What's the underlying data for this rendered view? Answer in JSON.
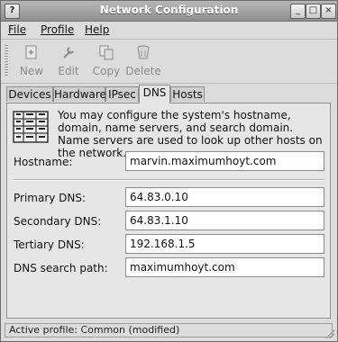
{
  "window": {
    "title": "Network Configuration"
  },
  "titlebar_buttons": {
    "help": "?",
    "minimize": "_",
    "maximize": "□",
    "close": "×"
  },
  "menu": [
    {
      "label": "File",
      "mnemonic": "F"
    },
    {
      "label": "Profile",
      "mnemonic": "P"
    },
    {
      "label": "Help",
      "mnemonic": "H"
    }
  ],
  "toolbar": {
    "new_label": "New",
    "edit_label": "Edit",
    "copy_label": "Copy",
    "delete_label": "Delete",
    "disabled": true
  },
  "tabs": [
    {
      "label": "Devices",
      "active": false
    },
    {
      "label": "Hardware",
      "active": false
    },
    {
      "label": "IPsec",
      "active": false
    },
    {
      "label": "DNS",
      "active": true
    },
    {
      "label": "Hosts",
      "active": false
    }
  ],
  "dns_panel": {
    "info_text": "You may configure the system's hostname, domain, name servers, and search domain. Name servers are used to look up other hosts on the network.",
    "hostname_label": "Hostname:",
    "hostname_value": "marvin.maximumhoyt.com",
    "primary_label": "Primary DNS:",
    "primary_value": "64.83.0.10",
    "secondary_label": "Secondary DNS:",
    "secondary_value": "64.83.1.10",
    "tertiary_label": "Tertiary DNS:",
    "tertiary_value": "192.168.1.5",
    "search_label": "DNS search path:",
    "search_value": "maximumhoyt.com"
  },
  "status": {
    "text": "Active profile: Common (modified)"
  },
  "colors": {
    "titlebar": "#9a9a9a",
    "window_bg": "#dcdcdc",
    "field_bg": "#ffffff"
  }
}
